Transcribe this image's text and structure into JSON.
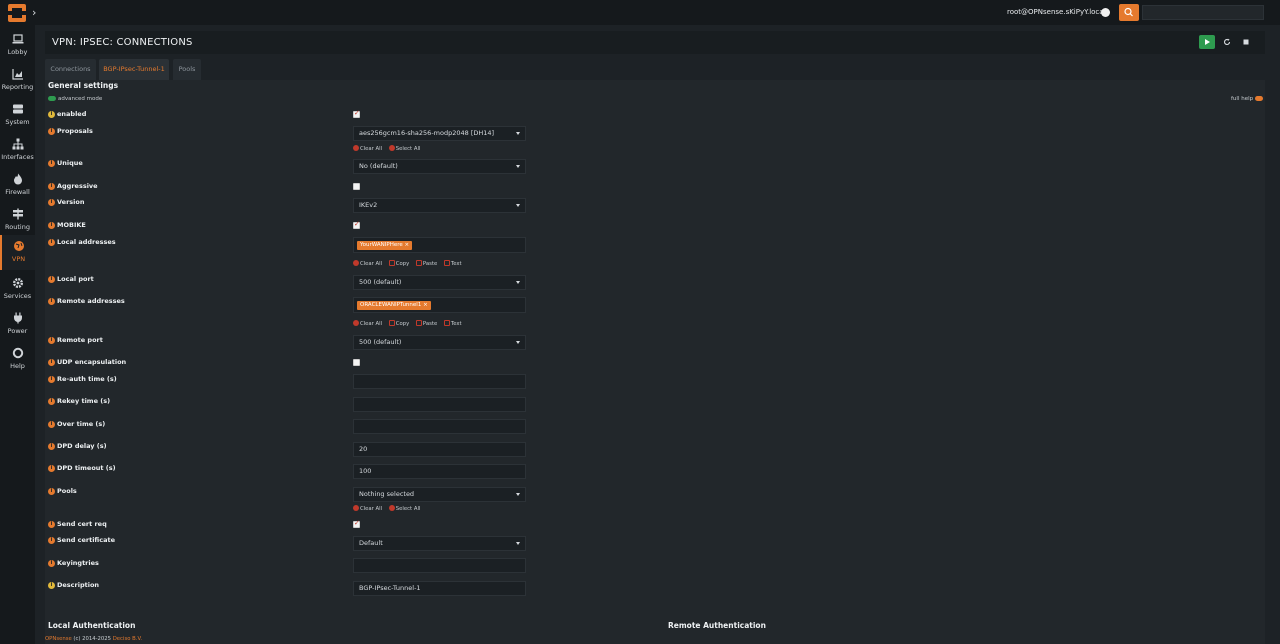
{
  "app": {
    "user": "root@OPNsense.sKiPyY.local"
  },
  "sidebar": {
    "items": [
      {
        "label": "Lobby",
        "icon": "laptop-icon"
      },
      {
        "label": "Reporting",
        "icon": "chart-icon"
      },
      {
        "label": "System",
        "icon": "server-icon"
      },
      {
        "label": "Interfaces",
        "icon": "sitemap-icon"
      },
      {
        "label": "Firewall",
        "icon": "fire-icon"
      },
      {
        "label": "Routing",
        "icon": "signpost-icon"
      },
      {
        "label": "VPN",
        "icon": "globe-icon"
      },
      {
        "label": "Services",
        "icon": "cog-icon"
      },
      {
        "label": "Power",
        "icon": "plug-icon"
      },
      {
        "label": "Help",
        "icon": "lifebuoy-icon"
      }
    ],
    "active_index": 6
  },
  "page": {
    "title": "VPN: IPSEC: CONNECTIONS"
  },
  "tabs": [
    {
      "label": "Connections"
    },
    {
      "label": "BGP-IPsec-Tunnel-1"
    },
    {
      "label": "Pools"
    }
  ],
  "form": {
    "section_title": "General settings",
    "advanced_mode": "advanced mode",
    "full_help": "full help",
    "fields": {
      "enabled": {
        "label": "enabled",
        "checked": true
      },
      "proposals": {
        "label": "Proposals",
        "value": "aes256gcm16-sha256-modp2048 [DH14]"
      },
      "unique": {
        "label": "Unique",
        "value": "No (default)"
      },
      "aggressive": {
        "label": "Aggressive",
        "checked": false
      },
      "version": {
        "label": "Version",
        "value": "IKEv2"
      },
      "mobike": {
        "label": "MOBIKE",
        "checked": true
      },
      "local_addresses": {
        "label": "Local addresses",
        "tag": "YourWANIPHere"
      },
      "local_port": {
        "label": "Local port",
        "value": "500 (default)"
      },
      "remote_addresses": {
        "label": "Remote addresses",
        "tag": "ORACLEWANIPTunnel1"
      },
      "remote_port": {
        "label": "Remote port",
        "value": "500 (default)"
      },
      "udp_encap": {
        "label": "UDP encapsulation",
        "checked": false
      },
      "reauth_time": {
        "label": "Re-auth time (s)",
        "value": ""
      },
      "rekey_time": {
        "label": "Rekey time (s)",
        "value": ""
      },
      "over_time": {
        "label": "Over time (s)",
        "value": ""
      },
      "dpd_delay": {
        "label": "DPD delay (s)",
        "value": "20"
      },
      "dpd_timeout": {
        "label": "DPD timeout (s)",
        "value": "100"
      },
      "pools": {
        "label": "Pools",
        "value": "Nothing selected"
      },
      "send_cert_req": {
        "label": "Send cert req",
        "checked": true
      },
      "send_certificate": {
        "label": "Send certificate",
        "value": "Default"
      },
      "keyingtries": {
        "label": "Keyingtries",
        "value": ""
      },
      "description": {
        "label": "Description",
        "value": "BGP-IPsec-Tunnel-1"
      }
    },
    "actions": {
      "clear_all": "Clear All",
      "select_all": "Select All",
      "copy": "Copy",
      "paste": "Paste",
      "text": "Text"
    }
  },
  "bottom": {
    "local_auth": "Local Authentication",
    "remote_auth": "Remote Authentication"
  },
  "footer": {
    "brand": "OPNsense",
    "copyright": "(c) 2014-2025",
    "company": "Deciso B.V."
  },
  "colors": {
    "accent": "#e57a2e",
    "start_button": "#2e9b4f"
  }
}
